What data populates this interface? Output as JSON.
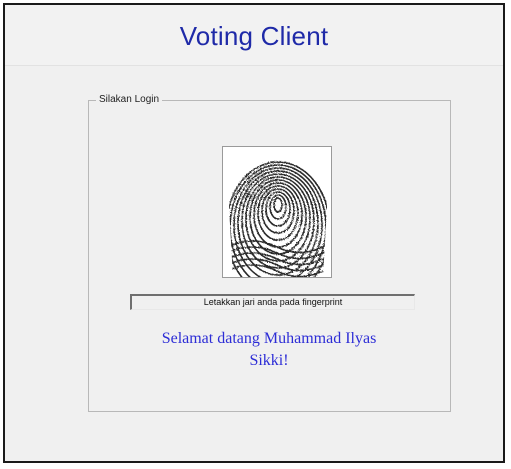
{
  "window": {
    "title": "Voting Client"
  },
  "login_group": {
    "legend": "Silakan Login",
    "fingerprint_icon": "fingerprint-image",
    "status_text": "Letakkan jari anda pada fingerprint",
    "welcome_line1": "Selamat datang Muhammad Ilyas",
    "welcome_line2": "Sikki!"
  },
  "colors": {
    "title": "#1f2aa8",
    "welcome": "#2d2dd6",
    "background": "#f0f0f0"
  }
}
